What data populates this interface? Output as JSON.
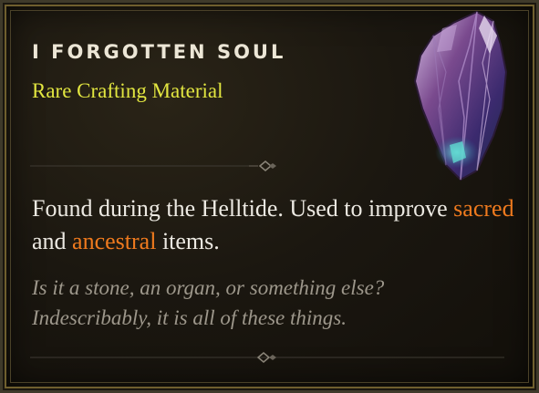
{
  "item": {
    "name": "I Forgotten Soul",
    "type": "Rare Crafting Material",
    "description": {
      "part1": "Found during the Helltide. Used to improve ",
      "highlight1": "sacred",
      "part2": " and  ",
      "highlight2": "ancestral",
      "part3": " items."
    },
    "flavor_line1": "Is it a stone, an organ, or something else?",
    "flavor_line2": "Indescribably, it is all of these things.",
    "icon": "forgotten-soul-crystal-icon"
  },
  "colors": {
    "item_type": "#e2e640",
    "highlight": "#ef7a1e",
    "flavor": "#9d978b",
    "text": "#ece9e2",
    "frame": "#6f5f2e"
  }
}
